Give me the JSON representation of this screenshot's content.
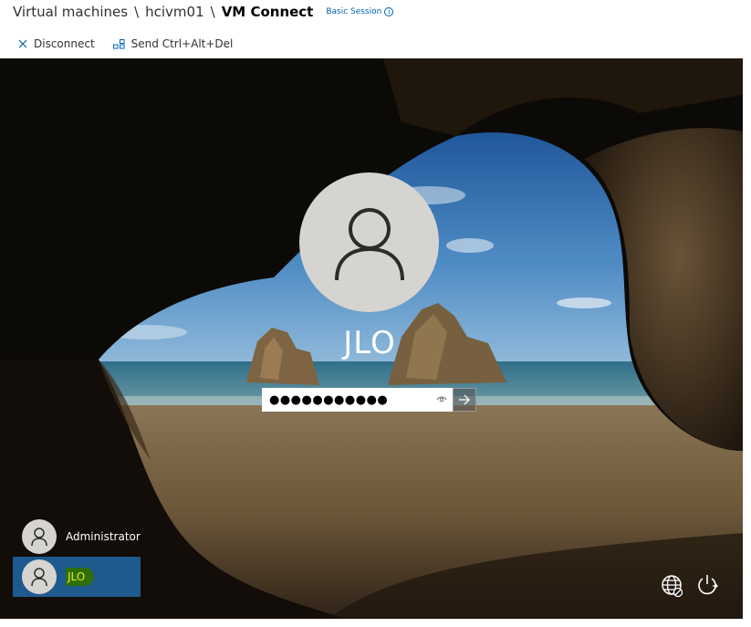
{
  "header": {
    "breadcrumb": [
      "Virtual machines",
      "hcivm01",
      "VM Connect"
    ],
    "separator": "\\",
    "session_mode": "Basic Session"
  },
  "toolbar": {
    "disconnect_label": "Disconnect",
    "send_cad_label": "Send Ctrl+Alt+Del"
  },
  "login": {
    "current_user": "JLO",
    "password_mask": "●●●●●●●●●●●",
    "icons": {
      "avatar": "user-icon",
      "reveal": "eye-icon",
      "submit": "arrow-right-icon"
    }
  },
  "users": [
    {
      "name": "Administrator",
      "selected": false
    },
    {
      "name": "JLO",
      "selected": true
    }
  ],
  "system_icons": [
    "network-icon",
    "power-icon"
  ],
  "colors": {
    "selected_user_bg": "#1e5a8e",
    "link_blue": "#0063b1",
    "highlight_text": "#e8f020"
  }
}
